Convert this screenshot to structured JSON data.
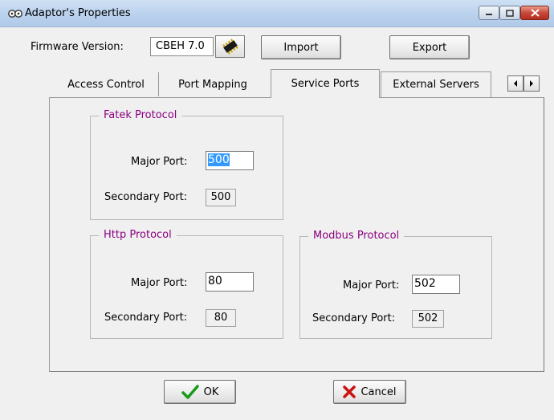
{
  "window": {
    "title": "Adaptor's Properties"
  },
  "firmware": {
    "label": "Firmware Version:",
    "value": "CBEH 7.0"
  },
  "toolbar": {
    "import_label": "Import",
    "export_label": "Export"
  },
  "tabs": [
    {
      "label": "Access Control"
    },
    {
      "label": "Port Mapping"
    },
    {
      "label": "Service Ports"
    },
    {
      "label": "External Servers"
    }
  ],
  "active_tab": "Service Ports",
  "fatek": {
    "title": "Fatek Protocol",
    "major_label": "Major Port:",
    "major_value": "500",
    "secondary_label": "Secondary Port:",
    "secondary_value": "500"
  },
  "http": {
    "title": "Http Protocol",
    "major_label": "Major Port:",
    "major_value": "80",
    "secondary_label": "Secondary Port:",
    "secondary_value": "80"
  },
  "modbus": {
    "title": "Modbus Protocol",
    "major_label": "Major Port:",
    "major_value": "502",
    "secondary_label": "Secondary Port:",
    "secondary_value": "502"
  },
  "footer": {
    "ok_label": "OK",
    "cancel_label": "Cancel"
  },
  "icons": {
    "app": "gear-chain-icon",
    "chip": "chip-icon",
    "ok": "checkmark-icon",
    "cancel": "x-icon",
    "tab_left": "arrow-left-icon",
    "tab_right": "arrow-right-icon"
  },
  "colors": {
    "group_title": "#8a007f",
    "selection": "#3399ff",
    "ok_check": "#1a9a1a",
    "cancel_x": "#cc1111"
  }
}
